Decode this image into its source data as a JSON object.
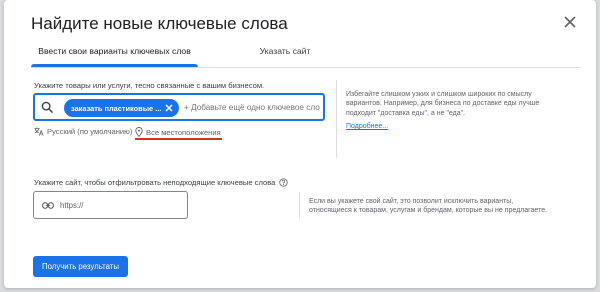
{
  "dialog": {
    "title": "Найдите новые ключевые слова",
    "close_icon": "close-icon"
  },
  "tabs": [
    {
      "label": "Ввести свои варианты ключевых слов",
      "active": true
    },
    {
      "label": "Указать сайт",
      "active": false
    }
  ],
  "keywords": {
    "label": "Укажите товары или услуги, тесно связанные с вашим бизнесом.",
    "chip": "заказать пластиковые ...",
    "placeholder": "+ Добавьте ещё одно ключевое сло",
    "hint": [
      "Избегайте слишком узких и слишком широких по смыслу",
      "вариантов. Например, для бизнеса по доставке еды лучше",
      "подходит \"доставка еды\", а не \"еда\"."
    ],
    "more_link": "Подробнее...",
    "language": "Русский (по умолчанию)",
    "location": "Все местоположения"
  },
  "site": {
    "label": "Укажите сайт, чтобы отфильтровать неподходящие ключевые слова",
    "placeholder": "https://",
    "hint": [
      "Если вы укажете свой сайт, это позволит исключить варианты,",
      "относящиеся к товарам, услугам и брендам, которые вы не предлагаете."
    ]
  },
  "submit_label": "Получить результаты",
  "colors": {
    "accent": "#1a73e8",
    "error_underline": "#d93025"
  }
}
